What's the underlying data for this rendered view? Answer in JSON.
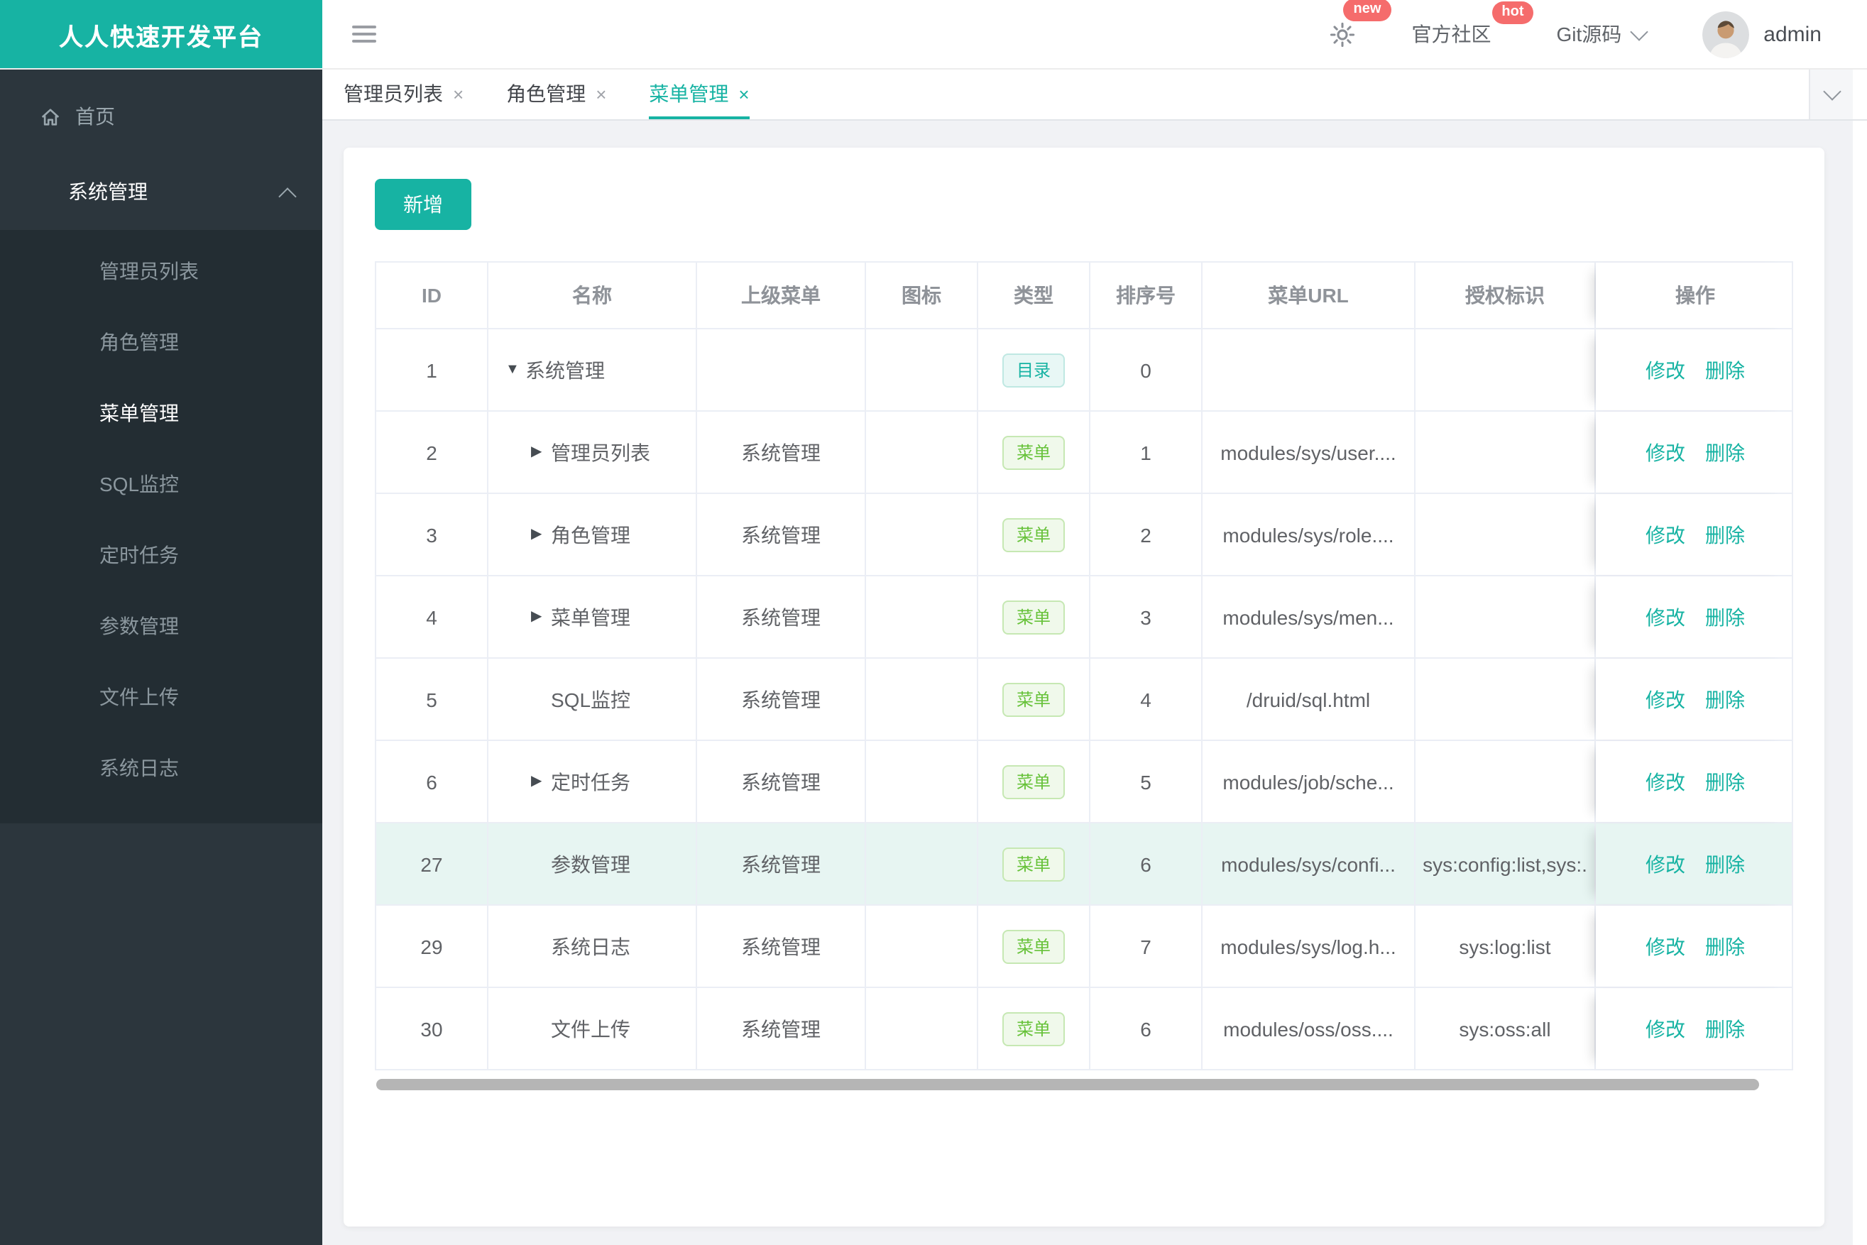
{
  "app": {
    "logo_title": "人人快速开发平台"
  },
  "topbar": {
    "badge_new": "new",
    "community_label": "官方社区",
    "badge_hot": "hot",
    "git_label": "Git源码",
    "user_name": "admin"
  },
  "sidebar": {
    "home_label": "首页",
    "group_label": "系统管理",
    "items": [
      {
        "key": "admin-list",
        "label": "管理员列表",
        "active": false
      },
      {
        "key": "role-mgmt",
        "label": "角色管理",
        "active": false
      },
      {
        "key": "menu-mgmt",
        "label": "菜单管理",
        "active": true
      },
      {
        "key": "sql-monitor",
        "label": "SQL监控",
        "active": false
      },
      {
        "key": "scheduled-tasks",
        "label": "定时任务",
        "active": false
      },
      {
        "key": "param-mgmt",
        "label": "参数管理",
        "active": false
      },
      {
        "key": "file-upload",
        "label": "文件上传",
        "active": false
      },
      {
        "key": "system-log",
        "label": "系统日志",
        "active": false
      }
    ]
  },
  "tabs": [
    {
      "key": "admin-list",
      "label": "管理员列表",
      "active": false
    },
    {
      "key": "role-mgmt",
      "label": "角色管理",
      "active": false
    },
    {
      "key": "menu-mgmt",
      "label": "菜单管理",
      "active": true
    }
  ],
  "toolbar": {
    "add_label": "新增"
  },
  "table": {
    "columns": [
      "ID",
      "名称",
      "上级菜单",
      "图标",
      "类型",
      "排序号",
      "菜单URL",
      "授权标识",
      "操作"
    ],
    "op_labels": [
      "修改",
      "删除"
    ],
    "rows": [
      {
        "id": "1",
        "arrow": "down",
        "level": 0,
        "name": "系统管理",
        "parent": "",
        "type": "目录",
        "type_variant": "dir",
        "order": "0",
        "url": "",
        "perm": "",
        "highlight": false
      },
      {
        "id": "2",
        "arrow": "right",
        "level": 1,
        "name": "管理员列表",
        "parent": "系统管理",
        "type": "菜单",
        "type_variant": "menu",
        "order": "1",
        "url": "modules/sys/user....",
        "perm": "",
        "highlight": false
      },
      {
        "id": "3",
        "arrow": "right",
        "level": 1,
        "name": "角色管理",
        "parent": "系统管理",
        "type": "菜单",
        "type_variant": "menu",
        "order": "2",
        "url": "modules/sys/role....",
        "perm": "",
        "highlight": false
      },
      {
        "id": "4",
        "arrow": "right",
        "level": 1,
        "name": "菜单管理",
        "parent": "系统管理",
        "type": "菜单",
        "type_variant": "menu",
        "order": "3",
        "url": "modules/sys/men...",
        "perm": "",
        "highlight": false
      },
      {
        "id": "5",
        "arrow": null,
        "level": 1,
        "name": "SQL监控",
        "parent": "系统管理",
        "type": "菜单",
        "type_variant": "menu",
        "order": "4",
        "url": "/druid/sql.html",
        "perm": "",
        "highlight": false
      },
      {
        "id": "6",
        "arrow": "right",
        "level": 1,
        "name": "定时任务",
        "parent": "系统管理",
        "type": "菜单",
        "type_variant": "menu",
        "order": "5",
        "url": "modules/job/sche...",
        "perm": "",
        "highlight": false
      },
      {
        "id": "27",
        "arrow": null,
        "level": 1,
        "name": "参数管理",
        "parent": "系统管理",
        "type": "菜单",
        "type_variant": "menu",
        "order": "6",
        "url": "modules/sys/confi...",
        "perm": "sys:config:list,sys:.",
        "highlight": true
      },
      {
        "id": "29",
        "arrow": null,
        "level": 1,
        "name": "系统日志",
        "parent": "系统管理",
        "type": "菜单",
        "type_variant": "menu",
        "order": "7",
        "url": "modules/sys/log.h...",
        "perm": "sys:log:list",
        "highlight": false
      },
      {
        "id": "30",
        "arrow": null,
        "level": 1,
        "name": "文件上传",
        "parent": "系统管理",
        "type": "菜单",
        "type_variant": "menu",
        "order": "6",
        "url": "modules/oss/oss....",
        "perm": "sys:oss:all",
        "highlight": false
      }
    ]
  },
  "colors": {
    "primary": "#17b3a3",
    "badge_red": "#f56c6c",
    "tag_dir_text": "#17b3a3",
    "tag_menu_text": "#67c23a",
    "row_highlight": "#e7f5f2",
    "sidebar_bg": "#2c363d",
    "sidebar_submenu_bg": "#232d33"
  }
}
